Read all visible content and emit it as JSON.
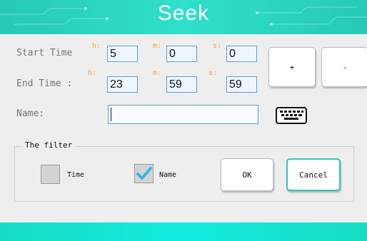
{
  "header": {
    "title": "Seek"
  },
  "time": {
    "start_label": "Start Time",
    "end_label": "End Time  :",
    "units": {
      "h": "h:",
      "m": "m:",
      "s": "s:"
    },
    "start": {
      "h": "5",
      "m": "0",
      "s": "0"
    },
    "end": {
      "h": "23",
      "m": "59",
      "s": "59"
    }
  },
  "adjust": {
    "plus": "+",
    "minus": "-"
  },
  "name": {
    "label": "Name:",
    "value": ""
  },
  "icons": {
    "keyboard": "keyboard-icon",
    "check": "check-icon"
  },
  "filter": {
    "legend": "The filter",
    "time_label": "Time",
    "time_checked": false,
    "name_label": "Name",
    "name_checked": true
  },
  "actions": {
    "ok": "OK",
    "cancel": "Cancel"
  },
  "colors": {
    "accent": "#2ec6b0",
    "unit": "#f2a33a",
    "field_border": "#5aa0dd"
  }
}
